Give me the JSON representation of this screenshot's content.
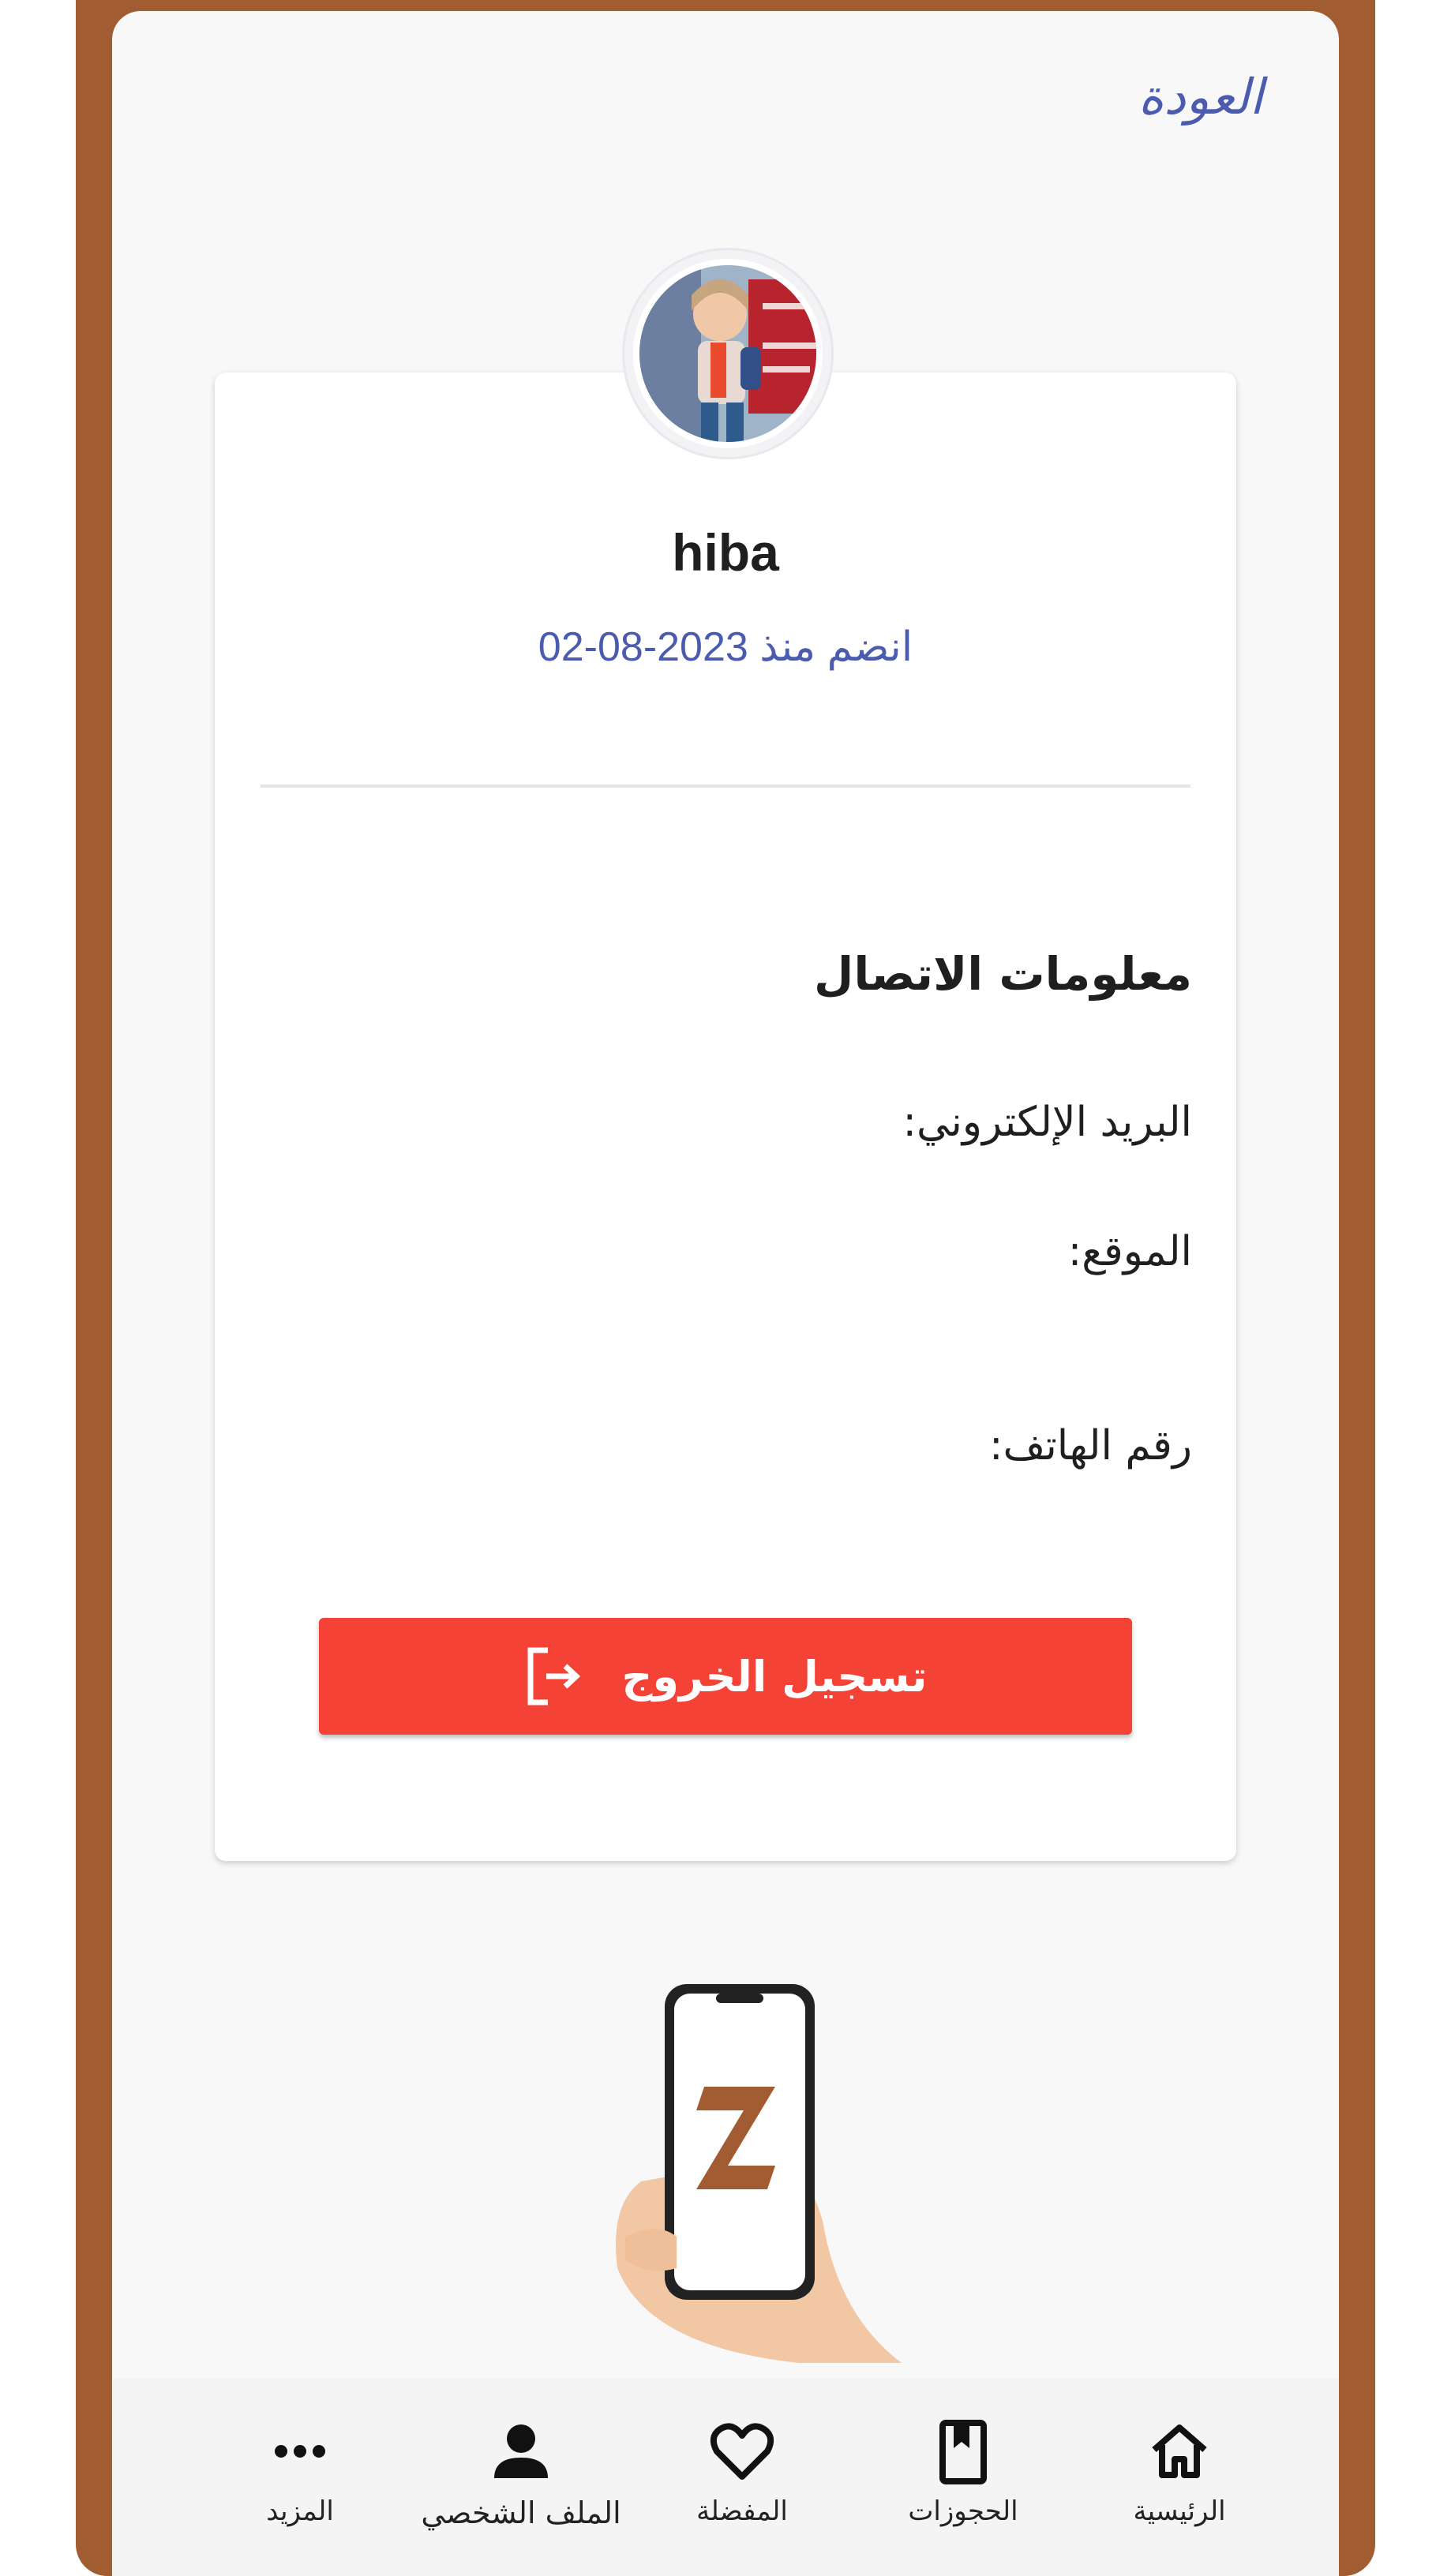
{
  "header": {
    "back_label": "العودة"
  },
  "profile": {
    "username": "hiba",
    "joined_text": "انضم منذ 2023-08-02"
  },
  "contact": {
    "title": "معلومات الاتصال",
    "email_label": "البريد الإلكتروني:",
    "location_label": "الموقع:",
    "phone_label": "رقم الهاتف:"
  },
  "actions": {
    "logout_label": "تسجيل الخروج"
  },
  "nav": {
    "items": [
      {
        "label": "الرئيسية",
        "icon": "home-icon"
      },
      {
        "label": "الحجوزات",
        "icon": "bookmark-icon"
      },
      {
        "label": "المفضلة",
        "icon": "heart-icon"
      },
      {
        "label": "الملف الشخصي",
        "icon": "person-icon"
      },
      {
        "label": "المزيد",
        "icon": "more-icon"
      }
    ]
  },
  "colors": {
    "frame": "#a15c32",
    "accent": "#4a5bb0",
    "logout": "#f44336"
  }
}
